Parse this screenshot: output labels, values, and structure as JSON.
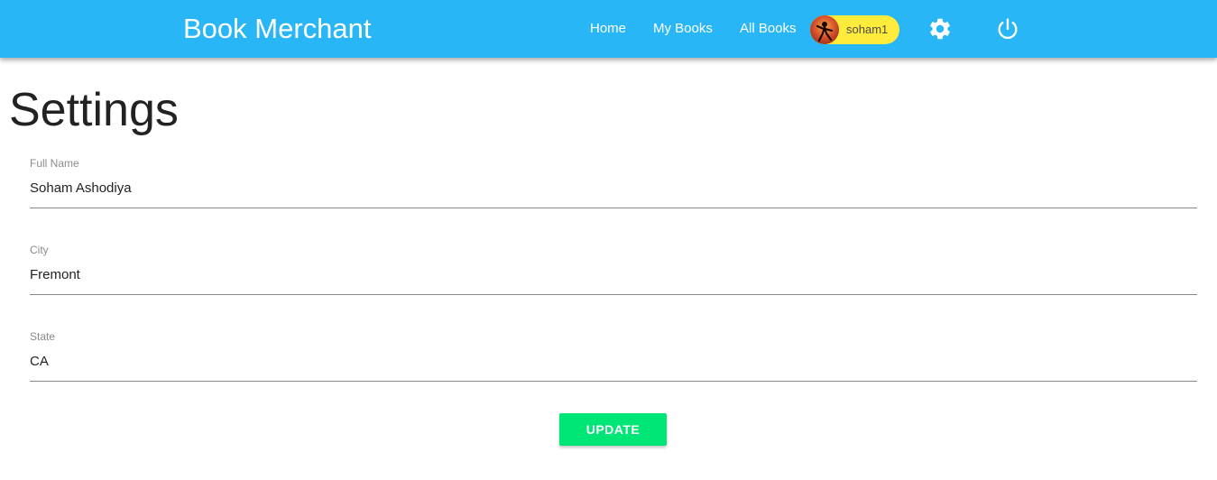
{
  "header": {
    "brand": "Book Merchant",
    "nav": {
      "home": "Home",
      "my_books": "My Books",
      "all_books": "All Books"
    },
    "user_chip": {
      "username": "soham1",
      "avatar_icon": "user-avatar-icon"
    },
    "settings_icon": "gear-icon",
    "logout_icon": "power-icon",
    "colors": {
      "bar": "#29b6f6",
      "chip": "#ffeb3b"
    }
  },
  "page": {
    "title": "Settings",
    "fields": [
      {
        "label": "Full Name",
        "value": "Soham Ashodiya"
      },
      {
        "label": "City",
        "value": "Fremont"
      },
      {
        "label": "State",
        "value": "CA"
      }
    ],
    "update_label": "UPDATE",
    "update_color": "#00e676"
  }
}
